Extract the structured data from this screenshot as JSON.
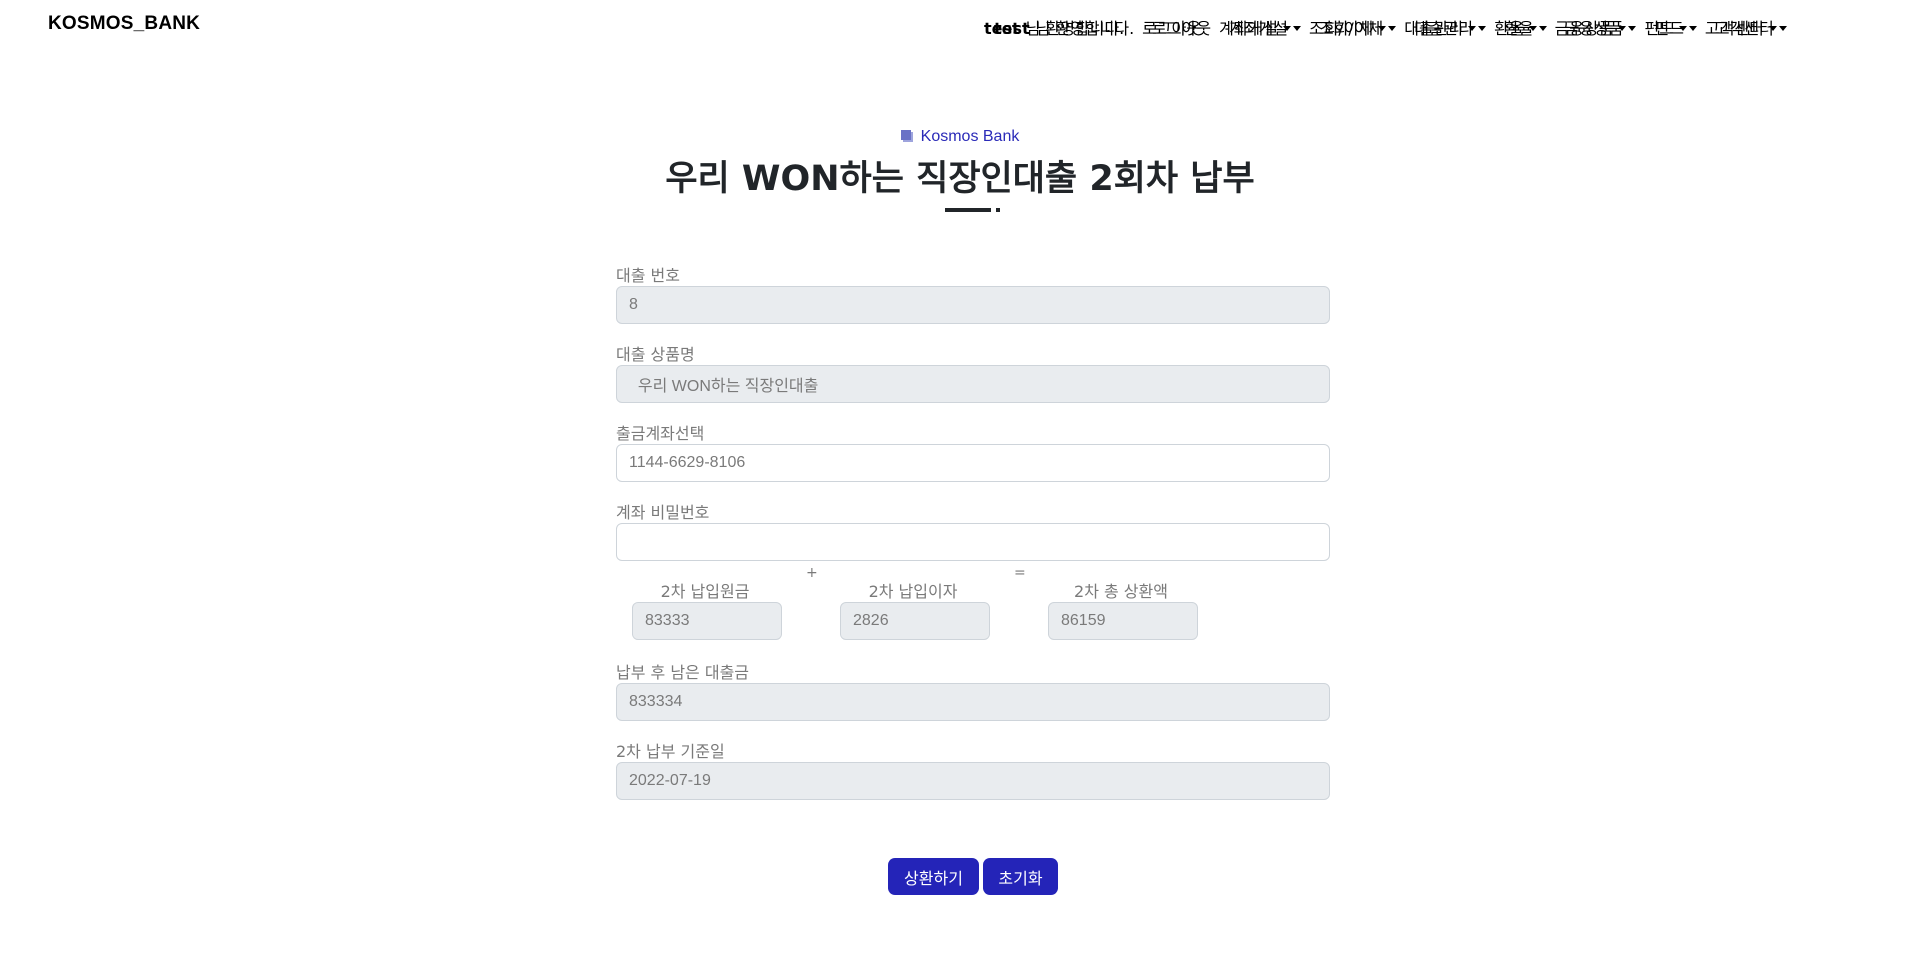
{
  "navbar": {
    "brand": "KOSMOS_BANK",
    "layer_a": {
      "user": "test",
      "greeting": "님 환영합니다.",
      "items": [
        "로그아웃",
        "계좌개설",
        "조회/이체",
        "대출관리",
        "환율",
        "금융상품",
        "펀드",
        "고객센터"
      ]
    },
    "layer_b": {
      "user": "test",
      "greeting": "님 환영합니다.",
      "items": [
        "로그아웃",
        "계좌개설",
        "조회/이체",
        "대출관리",
        "환율",
        "금융상품",
        "펀드",
        "고객센터"
      ]
    }
  },
  "section_tag": "Kosmos Bank",
  "page_title": "우리 WON하는 직장인대출 2회차 납부",
  "form": {
    "loan_number": {
      "label": "대출 번호",
      "value": "8"
    },
    "product_name": {
      "label": "대출 상품명",
      "value": "  우리 WON하는 직장인대출"
    },
    "withdraw_account": {
      "label": "출금계좌선택",
      "value": "1144-6629-8106"
    },
    "account_password": {
      "label": "계좌 비밀번호",
      "value": ""
    },
    "principal": {
      "label": "2차 납입원금",
      "value": "83333"
    },
    "plus_sign": "+",
    "interest": {
      "label": "2차 납입이자",
      "value": "2826"
    },
    "equals_sign": "=",
    "total": {
      "label": "2차 총 상환액",
      "value": "86159"
    },
    "remaining": {
      "label": "납부 후 남은 대출금",
      "value": "833334"
    },
    "due_date": {
      "label": "2차 납부 기준일",
      "value": "2022-07-19"
    }
  },
  "buttons": {
    "repay": "상환하기",
    "reset": "초기화"
  },
  "colors": {
    "primary": "#2424b8",
    "readonly_bg": "#e9ecef",
    "label": "#7a7a7a"
  }
}
